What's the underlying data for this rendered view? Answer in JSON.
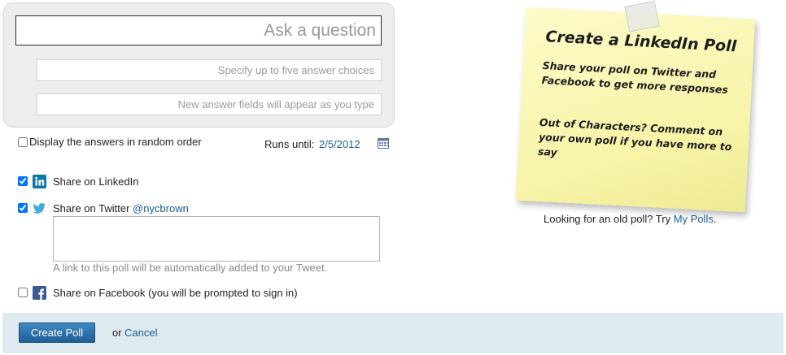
{
  "question": {
    "placeholder": "Ask a question",
    "answer_placeholders": [
      "Specify up to five answer choices",
      "New answer fields will appear as you type"
    ]
  },
  "options": {
    "random_order_label": "Display the answers in random order",
    "random_order_checked": false,
    "runs_until_label": "Runs until:",
    "runs_until_date": "2/5/2012",
    "calendar_icon": "calendar-icon"
  },
  "share": {
    "linkedin": {
      "label": "Share on LinkedIn",
      "checked": true,
      "icon": "linkedin-icon",
      "color": "#0e76a8"
    },
    "twitter": {
      "label": "Share on Twitter",
      "handle": "@nycbrown",
      "checked": true,
      "icon": "twitter-bird-icon",
      "color": "#3fa9e0",
      "tweet_text": "",
      "note": "A link to this poll will be automatically added to your Tweet."
    },
    "facebook": {
      "label": "Share on Facebook (you will be prompted to sign in)",
      "checked": false,
      "icon": "facebook-icon",
      "color": "#3b5998"
    }
  },
  "actions": {
    "create_label": "Create Poll",
    "or_text": "or",
    "cancel_label": "Cancel"
  },
  "sticky_note": {
    "title": "Create a LinkedIn Poll",
    "line1": "Share your poll on Twitter and Facebook to get more responses",
    "line2": "Out of Characters? Comment on your own poll if you have more to say"
  },
  "old_poll": {
    "text": "Looking for an old poll? Try ",
    "link": "My Polls",
    "suffix": "."
  },
  "colors": {
    "accent": "#1a5e96",
    "footer": "#dfe9f0",
    "note": "#f8f4ad"
  }
}
